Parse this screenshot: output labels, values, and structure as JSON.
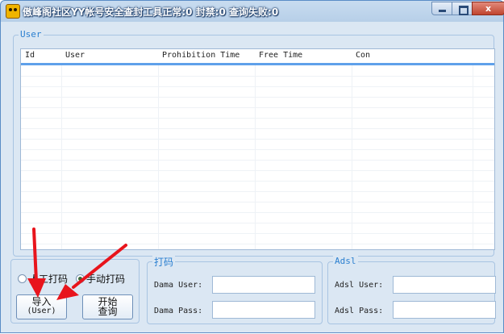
{
  "window": {
    "title": "傲峰阁社区YY帐号安全查封工具正常:0 封禁:0 查询失败:0",
    "controls": {
      "minimize": "",
      "maximize": "",
      "close": "x"
    }
  },
  "user_group": {
    "title": "User",
    "columns": [
      "Id",
      "User",
      "Prohibition Time",
      "Free Time",
      "Con"
    ],
    "rows": []
  },
  "left_panel": {
    "radio_manual": {
      "label": "人工打码",
      "checked": false
    },
    "radio_auto": {
      "label": "手动打码",
      "checked": true
    },
    "import_button": {
      "line1": "导入",
      "line2": "(User)"
    },
    "start_button": {
      "line1": "开始",
      "line2": "查询"
    }
  },
  "dama_group": {
    "title": "打码",
    "user_label": "Dama User:",
    "pass_label": "Dama Pass:",
    "user_value": "",
    "pass_value": ""
  },
  "adsl_group": {
    "title": "Adsl",
    "user_label": "Adsl User:",
    "pass_label": "Adsl Pass:",
    "user_value": "",
    "pass_value": ""
  },
  "colors": {
    "annotation_arrow": "#e8141c",
    "header_accent": "#5fa0ea",
    "group_title": "#2a7fd0"
  }
}
